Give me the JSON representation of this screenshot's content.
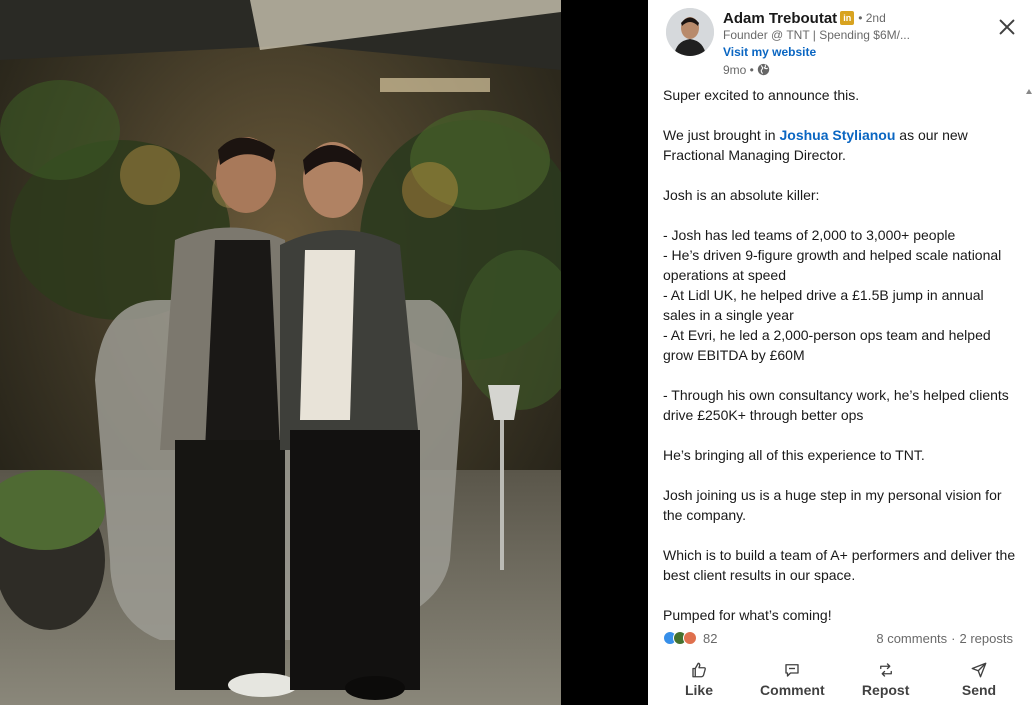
{
  "post": {
    "author": {
      "name": "Adam Treboutat",
      "badge": "in",
      "degree": "• 2nd",
      "headline": "Founder @ TNT | Spending $6M/...",
      "website_label": "Visit my website",
      "time": "9mo •"
    },
    "body": {
      "line1": "Super excited to announce this.",
      "intro_before": "We just brought in ",
      "mention": "Joshua Stylianou",
      "intro_after": " as our new Fractional Managing Director.",
      "line3": "Josh is an absolute killer:",
      "bullets": [
        " - Josh has led teams of 2,000 to 3,000+ people",
        " - He’s driven 9-figure growth and helped scale national operations at speed",
        " - At Lidl UK, he helped drive a £1.5B jump in annual sales in a single year",
        " - At Evri, he led a 2,000-person ops team and helped grow EBITDA by £60M"
      ],
      "bullet5": " - Through his own consultancy work, he’s helped clients drive £250K+ through better ops",
      "line5": "He’s bringing all of this experience to TNT.",
      "line6": "Josh joining us is a huge step in my personal vision for the company.",
      "line7": "Which is to build a team of A+ performers and deliver the best client results in our space.",
      "line8": "Pumped for what’s coming!"
    },
    "social": {
      "reaction_count": "82",
      "comments": "8 comments",
      "separator": "·",
      "reposts": "2 reposts"
    },
    "actions": {
      "like": "Like",
      "comment": "Comment",
      "repost": "Repost",
      "send": "Send"
    }
  },
  "colors": {
    "link": "#0a66c2",
    "badge": "#d8a320",
    "reaction_like": "#378fe9",
    "reaction_celebrate": "#44712e",
    "reaction_love": "#df704d"
  },
  "icons": [
    "close-icon",
    "globe-icon",
    "like-icon",
    "comment-icon",
    "repost-icon",
    "send-icon"
  ]
}
